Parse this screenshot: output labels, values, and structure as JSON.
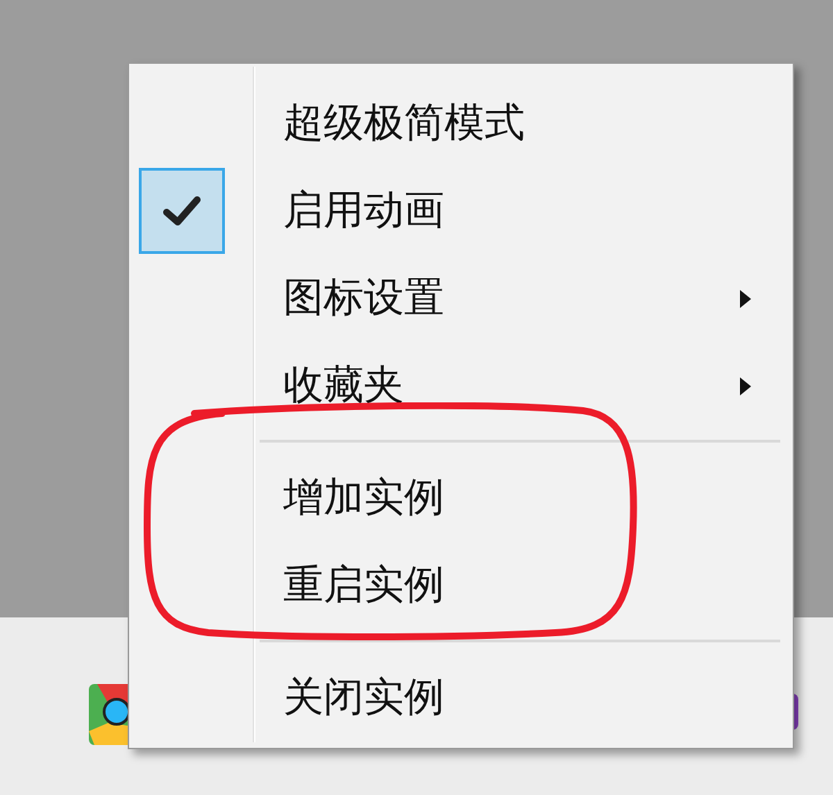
{
  "context_menu": {
    "items": [
      {
        "kind": "item",
        "label": "超级极简模式",
        "checked": false,
        "submenu": false
      },
      {
        "kind": "item",
        "label": "启用动画",
        "checked": true,
        "submenu": false
      },
      {
        "kind": "item",
        "label": "图标设置",
        "checked": false,
        "submenu": true
      },
      {
        "kind": "item",
        "label": "收藏夹",
        "checked": false,
        "submenu": true
      },
      {
        "kind": "separator"
      },
      {
        "kind": "item",
        "label": "增加实例",
        "checked": false,
        "submenu": false
      },
      {
        "kind": "item",
        "label": "重启实例",
        "checked": false,
        "submenu": false
      },
      {
        "kind": "separator"
      },
      {
        "kind": "item",
        "label": "关闭实例",
        "checked": false,
        "submenu": false
      }
    ]
  }
}
